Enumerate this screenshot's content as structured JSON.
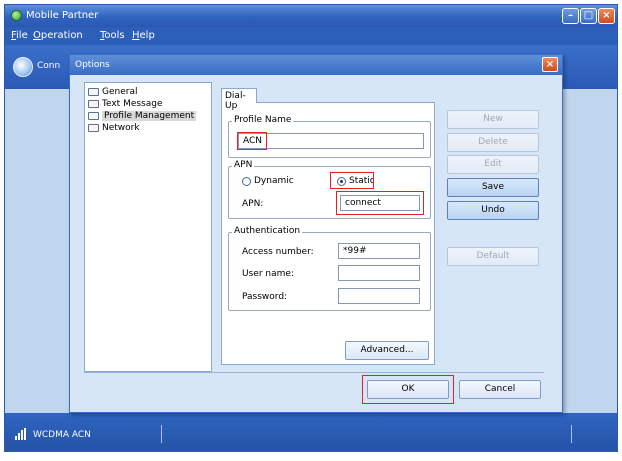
{
  "app": {
    "title": "Mobile Partner",
    "menu": [
      "File",
      "Operation",
      "Tools",
      "Help"
    ],
    "connect_label": "Conn",
    "status": {
      "network": "WCDMA  ACN"
    }
  },
  "dialog": {
    "title": "Options",
    "tree": [
      {
        "label": "General",
        "selected": false
      },
      {
        "label": "Text Message",
        "selected": false
      },
      {
        "label": "Profile Management",
        "selected": true
      },
      {
        "label": "Network",
        "selected": false
      }
    ],
    "tab": "Dial-Up",
    "profile_group": "Profile Name",
    "profile_name": "ACN",
    "apn_group": "APN",
    "apn_dynamic": "Dynamic",
    "apn_static": "Static",
    "apn_selected": "Static",
    "apn_label": "APN:",
    "apn_value": "connect",
    "auth_group": "Authentication",
    "access_number_label": "Access number:",
    "access_number_value": "*99#",
    "user_name_label": "User name:",
    "user_name_value": "",
    "password_label": "Password:",
    "password_value": "",
    "advanced_button": "Advanced...",
    "side_buttons": {
      "new": "New",
      "delete": "Delete",
      "edit": "Edit",
      "save": "Save",
      "undo": "Undo",
      "default": "Default"
    },
    "ok_button": "OK",
    "cancel_button": "Cancel"
  },
  "colors": {
    "highlight": "#e02424",
    "accent": "#2f63c0"
  }
}
